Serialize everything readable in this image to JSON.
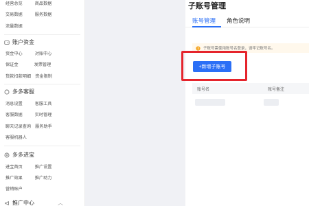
{
  "sidebar": {
    "rows": [
      {
        "a": "经营总览",
        "b": "商品数据"
      },
      {
        "a": "交易数据",
        "b": "服务数据"
      },
      {
        "a": "流量数据",
        "b": ""
      }
    ],
    "section_account": "账户资金",
    "account_rows": [
      {
        "a": "资金中心",
        "b": "对账中心"
      },
      {
        "a": "保证金",
        "b": "发票管理"
      },
      {
        "a": "货款扣款明细",
        "b": "资金限制"
      }
    ],
    "section_service": "多多客服",
    "service_rows": [
      {
        "a": "消息设置",
        "b": "客服工具"
      },
      {
        "a": "客服数据",
        "b": "实时管理"
      },
      {
        "a": "聊天记录查询",
        "b": "服务助手"
      },
      {
        "a": "客服机器人",
        "b": ""
      }
    ],
    "section_promo": "多多进宝",
    "promo_rows": [
      {
        "a": "进宝首页",
        "b": "推广设置"
      },
      {
        "a": "推广效果",
        "b": "推广助力"
      },
      {
        "a": "营销账户",
        "b": ""
      }
    ],
    "section_ad": "推广中心"
  },
  "main": {
    "title": "子账号管理",
    "tabs": [
      "账号管理",
      "角色说明"
    ],
    "notice": "子账号需使用账号名登录，请牢记账号名。",
    "add_button": "+新增子账号",
    "columns": [
      "账号名",
      "账号备注"
    ]
  },
  "colors": {
    "accent": "#2b6ff6",
    "highlight": "#e5242c",
    "notice_bg": "#fff8ec",
    "warning": "#f5a623"
  }
}
